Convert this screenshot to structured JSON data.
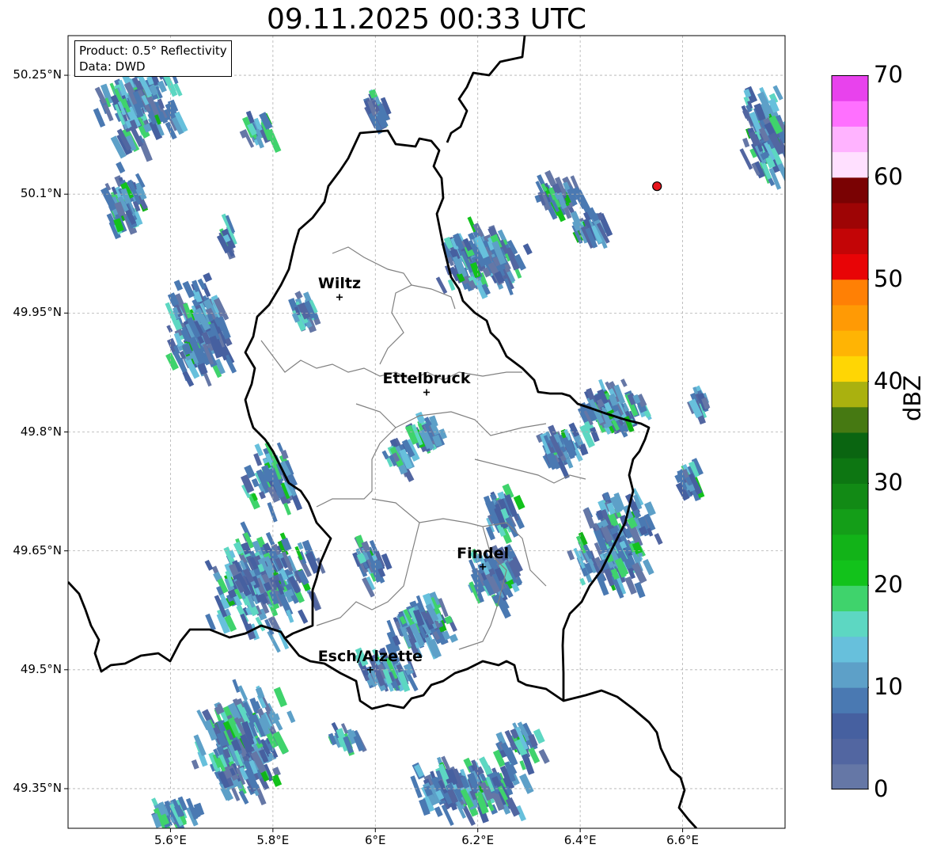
{
  "title": "09.11.2025 00:33 UTC",
  "info": {
    "line1": "Product: 0.5° Reflectivity",
    "line2": "Data: DWD"
  },
  "axes": {
    "lon_ticks": [
      "5.6°E",
      "5.8°E",
      "6°E",
      "6.2°E",
      "6.4°E",
      "6.6°E"
    ],
    "lat_ticks": [
      "50.25°N",
      "50.1°N",
      "49.95°N",
      "49.8°N",
      "49.65°N",
      "49.5°N",
      "49.35°N"
    ],
    "lon_range": [
      5.4,
      6.8
    ],
    "lat_range": [
      49.3,
      50.3
    ],
    "grid": true
  },
  "places": [
    {
      "name": "Wiltz",
      "lon": 5.93,
      "lat": 49.97
    },
    {
      "name": "Ettelbruck",
      "lon": 6.1,
      "lat": 49.85
    },
    {
      "name": "Findel",
      "lon": 6.21,
      "lat": 49.63
    },
    {
      "name": "Esch/Alzette",
      "lon": 5.99,
      "lat": 49.5
    }
  ],
  "radar_site": {
    "lon": 6.55,
    "lat": 50.11,
    "color": "#e8141c"
  },
  "colorbar": {
    "label": "dBZ",
    "ticks": [
      "70",
      "60",
      "50",
      "40",
      "30",
      "20",
      "10",
      "0"
    ],
    "colors": [
      "#6577a6",
      "#5266a1",
      "#4660a0",
      "#4a79b2",
      "#5da0c8",
      "#67c0dc",
      "#5dd7c2",
      "#3fd36c",
      "#12c21b",
      "#12b318",
      "#149e18",
      "#128a15",
      "#0d7612",
      "#0a6511",
      "#467912",
      "#aab10f",
      "#ffd604",
      "#ffb404",
      "#ff9a05",
      "#ff8005",
      "#e80406",
      "#c30506",
      "#9e0405",
      "#7a0203",
      "#ffe0ff",
      "#ffb3ff",
      "#ff70ff",
      "#e842ed"
    ]
  }
}
